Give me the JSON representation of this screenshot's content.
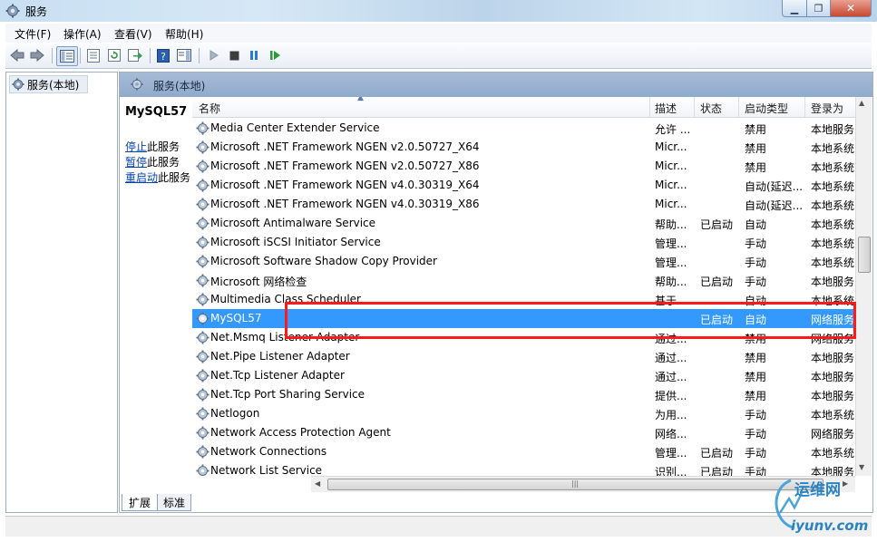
{
  "window": {
    "title": "服务"
  },
  "menu": [
    {
      "label": "文件(F)"
    },
    {
      "label": "操作(A)"
    },
    {
      "label": "查看(V)"
    },
    {
      "label": "帮助(H)"
    }
  ],
  "tree": {
    "root_label": "服务(本地)"
  },
  "panel": {
    "header": "服务(本地)",
    "selected_service": "MySQL57",
    "actions": [
      {
        "link": "停止",
        "suffix": "此服务"
      },
      {
        "link": "暂停",
        "suffix": "此服务"
      },
      {
        "link": "重启动",
        "suffix": "此服务"
      }
    ]
  },
  "columns": {
    "name": "名称",
    "desc": "描述",
    "status": "状态",
    "startup": "启动类型",
    "logon": "登录为"
  },
  "services": [
    {
      "name": "Media Center Extender Service",
      "desc": "允许 ...",
      "status": "",
      "startup": "禁用",
      "logon": "本地服务",
      "selected": false
    },
    {
      "name": "Microsoft .NET Framework NGEN v2.0.50727_X64",
      "desc": "Micr...",
      "status": "",
      "startup": "禁用",
      "logon": "本地系统",
      "selected": false
    },
    {
      "name": "Microsoft .NET Framework NGEN v2.0.50727_X86",
      "desc": "Micr...",
      "status": "",
      "startup": "禁用",
      "logon": "本地系统",
      "selected": false
    },
    {
      "name": "Microsoft .NET Framework NGEN v4.0.30319_X64",
      "desc": "Micr...",
      "status": "",
      "startup": "自动(延迟...",
      "logon": "本地系统",
      "selected": false
    },
    {
      "name": "Microsoft .NET Framework NGEN v4.0.30319_X86",
      "desc": "Micr...",
      "status": "",
      "startup": "自动(延迟...",
      "logon": "本地系统",
      "selected": false
    },
    {
      "name": "Microsoft Antimalware Service",
      "desc": "帮助...",
      "status": "已启动",
      "startup": "自动",
      "logon": "本地系统",
      "selected": false
    },
    {
      "name": "Microsoft iSCSI Initiator Service",
      "desc": "管理...",
      "status": "",
      "startup": "手动",
      "logon": "本地系统",
      "selected": false
    },
    {
      "name": "Microsoft Software Shadow Copy Provider",
      "desc": "管理...",
      "status": "",
      "startup": "手动",
      "logon": "本地系统",
      "selected": false
    },
    {
      "name": "Microsoft 网络检查",
      "desc": "帮助...",
      "status": "已启动",
      "startup": "手动",
      "logon": "本地服务",
      "selected": false
    },
    {
      "name": "Multimedia Class Scheduler",
      "desc": "基于...",
      "status": "",
      "startup": "自动",
      "logon": "本地系统",
      "selected": false
    },
    {
      "name": "MySQL57",
      "desc": "",
      "status": "已启动",
      "startup": "自动",
      "logon": "网络服务",
      "selected": true
    },
    {
      "name": "Net.Msmq Listener Adapter",
      "desc": "通过...",
      "status": "",
      "startup": "禁用",
      "logon": "网络服务",
      "selected": false
    },
    {
      "name": "Net.Pipe Listener Adapter",
      "desc": "通过...",
      "status": "",
      "startup": "禁用",
      "logon": "本地服务",
      "selected": false
    },
    {
      "name": "Net.Tcp Listener Adapter",
      "desc": "通过...",
      "status": "",
      "startup": "禁用",
      "logon": "本地服务",
      "selected": false
    },
    {
      "name": "Net.Tcp Port Sharing Service",
      "desc": "提供...",
      "status": "",
      "startup": "禁用",
      "logon": "本地服务",
      "selected": false
    },
    {
      "name": "Netlogon",
      "desc": "为用...",
      "status": "",
      "startup": "手动",
      "logon": "本地系统",
      "selected": false
    },
    {
      "name": "Network Access Protection Agent",
      "desc": "网络...",
      "status": "",
      "startup": "手动",
      "logon": "网络服务",
      "selected": false
    },
    {
      "name": "Network Connections",
      "desc": "管理...",
      "status": "已启动",
      "startup": "手动",
      "logon": "本地系统",
      "selected": false
    },
    {
      "name": "Network List Service",
      "desc": "识别...",
      "status": "已启动",
      "startup": "手动",
      "logon": "本地服务",
      "selected": false
    }
  ],
  "tabs": [
    {
      "label": "扩展"
    },
    {
      "label": "标准"
    }
  ],
  "watermark": {
    "brand": "运维网",
    "url": "iyunv.com"
  },
  "colors": {
    "selection": "#3399ff",
    "highlight_box": "#ff1a1a",
    "link": "#0645ad"
  }
}
